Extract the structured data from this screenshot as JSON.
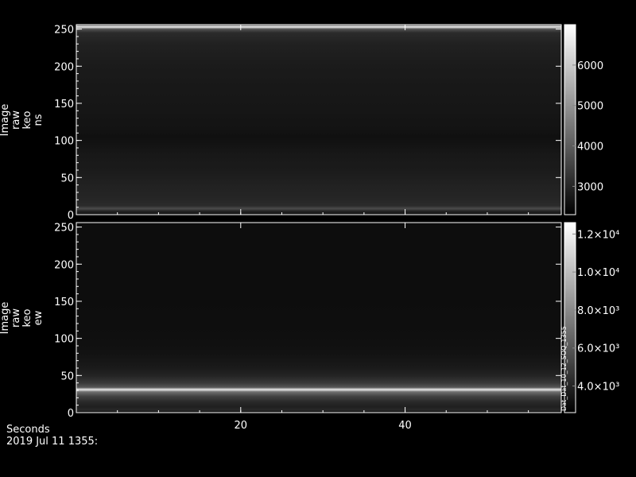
{
  "chart_data": [
    {
      "type": "heatmap",
      "ylabel": [
        "Image",
        "raw",
        "keo",
        "ns"
      ],
      "xlim": [
        0,
        59
      ],
      "ylim": [
        0,
        256
      ],
      "y_ticks": [
        0,
        50,
        100,
        150,
        200,
        250
      ],
      "y_tick_labels": [
        "0",
        "50",
        "100",
        "150",
        "200",
        "250"
      ],
      "x_ticks": [
        20,
        40
      ],
      "x_tick_labels": [
        "",
        ""
      ],
      "colorbar": {
        "range": [
          2300,
          7000
        ],
        "ticks": [
          3000,
          4000,
          5000,
          6000
        ],
        "tick_labels": [
          "3000",
          "4000",
          "5000",
          "6000"
        ]
      },
      "row_profile": {
        "rows": [
          0,
          5,
          8,
          12,
          20,
          40,
          60,
          80,
          95,
          105,
          115,
          140,
          170,
          200,
          230,
          245,
          250,
          253,
          256
        ],
        "values": [
          2600,
          3000,
          3700,
          3100,
          3000,
          2900,
          2800,
          2750,
          2650,
          2600,
          2650,
          2700,
          2750,
          2800,
          2900,
          3100,
          3800,
          6800,
          3000
        ]
      }
    },
    {
      "type": "heatmap",
      "ylabel": [
        "Image",
        "raw",
        "keo",
        "ew"
      ],
      "xlim": [
        0,
        59
      ],
      "ylim": [
        0,
        256
      ],
      "y_ticks": [
        0,
        50,
        100,
        150,
        200,
        250
      ],
      "y_tick_labels": [
        "0",
        "50",
        "100",
        "150",
        "200",
        "250"
      ],
      "x_ticks": [
        20,
        40
      ],
      "x_tick_labels": [
        "20",
        "40"
      ],
      "colorbar": {
        "range": [
          2600,
          12600
        ],
        "ticks": [
          4000,
          6000,
          8000,
          10000,
          12000
        ],
        "tick_labels": [
          "4.0×10³",
          "6.0×10³",
          "8.0×10³",
          "1.0×10⁴",
          "1.2×10⁴"
        ],
        "side_text": "Dat_Dat_10_12_SOQ_1355"
      },
      "row_profile": {
        "rows": [
          0,
          3,
          8,
          15,
          22,
          28,
          31,
          34,
          40,
          50,
          60,
          80,
          100,
          150,
          200,
          256
        ],
        "values": [
          2800,
          4200,
          3800,
          4300,
          5200,
          7000,
          11800,
          6000,
          4800,
          4000,
          3600,
          3300,
          3200,
          3100,
          3100,
          3100
        ]
      }
    }
  ],
  "footer": {
    "x_axis_title": "Seconds",
    "timestamp": "2019 Jul 11 1355:"
  }
}
